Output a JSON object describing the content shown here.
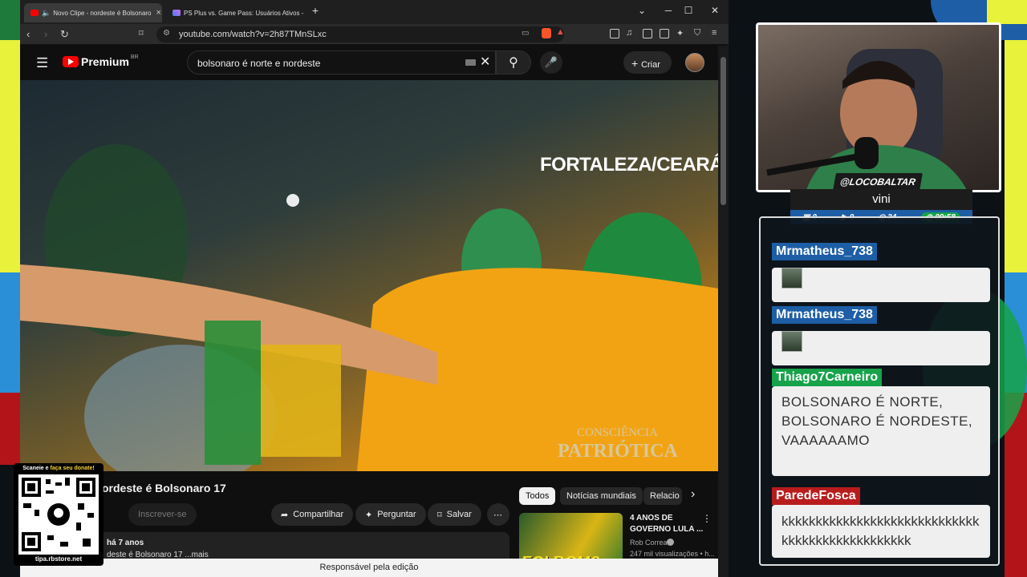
{
  "browser": {
    "tabs": [
      {
        "title": "Novo Clipe - nordeste é Bolsonaro",
        "active": true,
        "favicon": "youtube-favicon"
      },
      {
        "title": "PS Plus vs. Game Pass: Usuários Ativos - Goo",
        "active": false,
        "favicon": "gemini-favicon"
      }
    ],
    "new_tab": "+",
    "url": "youtube.com/watch?v=2h87TMnSLxc",
    "window_controls": {
      "minimize": "─",
      "maximize": "☐",
      "close": "✕"
    }
  },
  "youtube": {
    "logo_text": "Premium",
    "logo_region": "BR",
    "search_query": "bolsonaro é norte e nordeste",
    "create_label": "Criar",
    "video_overlay": {
      "location": "FORTALEZA/CEARÁ",
      "watermark_line1": "CONSCIÊNCIA",
      "watermark_line2": "PATRIÓTICA"
    },
    "video_title": "ordeste é Bolsonaro 17",
    "subscribe_label": "Inscrever-se",
    "actions": {
      "share": "Compartilhar",
      "ask": "Perguntar",
      "save": "Salvar",
      "more": "⋯"
    },
    "description": {
      "meta": "há 7 anos",
      "text": "deste é Bolsonaro 17 ...mais"
    },
    "chips": [
      "Todos",
      "Notícias mundiais",
      "Relacio"
    ],
    "recommendation": {
      "title": "4 ANOS DE GOVERNO LULA ...",
      "channel": "Rob Correa",
      "meta": "247 mil visualizações • h...",
      "thumb_text": "FOI BOM?"
    },
    "status_bar": "Responsável pela edição"
  },
  "qr": {
    "header_prefix": "Scaneie e",
    "header_link": "faça seu donate!",
    "footer": "tipa.rbstore.net"
  },
  "stream": {
    "handle": "@LOCOBALTAR",
    "streamer_name": "vini",
    "stats": {
      "a": "0",
      "b": "0",
      "c": "34",
      "timer": "09:58"
    }
  },
  "chat": {
    "messages": [
      {
        "user": "Mrmatheus_738",
        "color": "#1d5ea6",
        "type": "emote",
        "text": ""
      },
      {
        "user": "Mrmatheus_738",
        "color": "#1d5ea6",
        "type": "emote",
        "text": ""
      },
      {
        "user": "Thiago7Carneiro",
        "color": "#16a34a",
        "type": "text",
        "text": "BOLSONARO É NORTE, BOLSONARO É NORDESTE, VAAAAAAMO"
      },
      {
        "user": "ParedeFosca",
        "color": "#b91c1c",
        "type": "text",
        "text": "kkkkkkkkkkkkkkkkkkkkkkkkkkkkkkkkkkkkkkkkkkkkkkkk"
      }
    ]
  }
}
